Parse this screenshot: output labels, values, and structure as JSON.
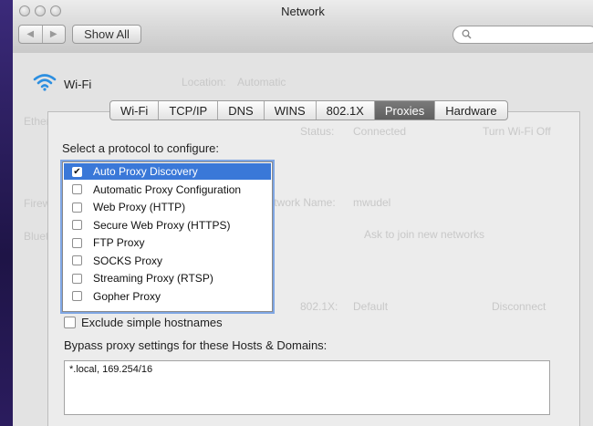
{
  "window": {
    "title": "Network"
  },
  "toolbar": {
    "back": "◀",
    "forward": "▶",
    "show_all": "Show All"
  },
  "network": {
    "name": "Wi-Fi",
    "background": {
      "location_label": "Location:",
      "location_value": "Automatic",
      "services": [
        "Ethernet",
        "Wi-Fi",
        "Firewire",
        "Bluetooth"
      ],
      "status_label": "Status:",
      "status_value": "Connected",
      "turn_off": "Turn Wi-Fi Off",
      "network_name_label": "Network Name:",
      "network_name_value": "mwudel",
      "ask_join": "Ask to join new networks",
      "auth_label": "802.1X:",
      "auth_value": "Default",
      "disconnect": "Disconnect"
    }
  },
  "tabs": [
    "Wi-Fi",
    "TCP/IP",
    "DNS",
    "WINS",
    "802.1X",
    "Proxies",
    "Hardware"
  ],
  "active_tab": "Proxies",
  "proxies": {
    "prompt": "Select a protocol to configure:",
    "protocols": [
      {
        "label": "Auto Proxy Discovery",
        "checked": true,
        "selected": true
      },
      {
        "label": "Automatic Proxy Configuration",
        "checked": false
      },
      {
        "label": "Web Proxy (HTTP)",
        "checked": false
      },
      {
        "label": "Secure Web Proxy (HTTPS)",
        "checked": false
      },
      {
        "label": "FTP Proxy",
        "checked": false
      },
      {
        "label": "SOCKS Proxy",
        "checked": false
      },
      {
        "label": "Streaming Proxy (RTSP)",
        "checked": false
      },
      {
        "label": "Gopher Proxy",
        "checked": false
      }
    ],
    "exclude_simple_hostnames": {
      "label": "Exclude simple hostnames",
      "checked": false
    },
    "bypass_label": "Bypass proxy settings for these Hosts & Domains:",
    "bypass_value": "*.local, 169.254/16"
  },
  "colors": {
    "selection": "#3a78d8",
    "active_tab": "#666666"
  }
}
